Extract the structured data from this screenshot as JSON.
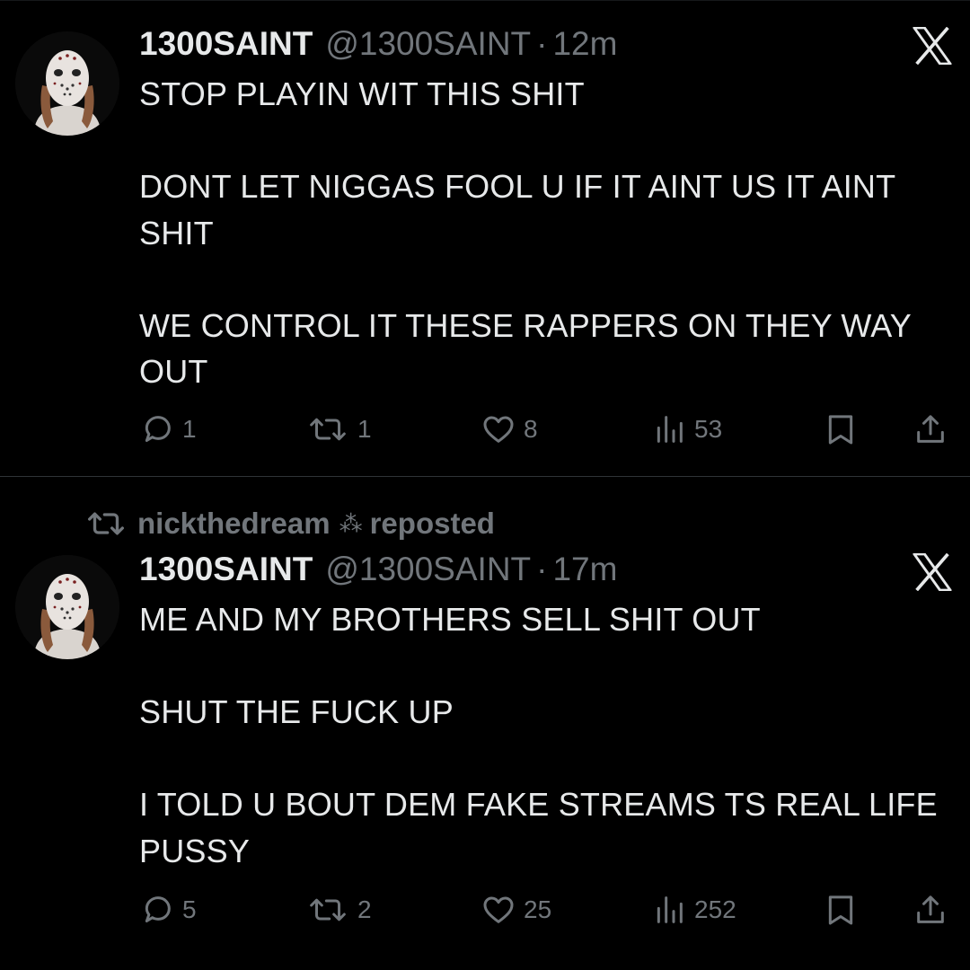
{
  "tweets": [
    {
      "author_name": "1300SAINT",
      "handle": "@1300SAINT",
      "separator": "·",
      "time": "12m",
      "text": "STOP PLAYIN WIT THIS SHIT\n\nDONT LET NIGGAS FOOL U IF IT AINT US IT AINT SHIT\n\nWE CONTROL IT THESE RAPPERS ON THEY WAY OUT",
      "replies": "1",
      "reposts": "1",
      "likes": "8",
      "views": "53"
    },
    {
      "repost_by": "nickthedream",
      "repost_sparkle": "⁂",
      "repost_label": "reposted",
      "author_name": "1300SAINT",
      "handle": "@1300SAINT",
      "separator": "·",
      "time": "17m",
      "text": "ME AND MY BROTHERS SELL SHIT OUT\n\nSHUT THE FUCK UP\n\nI TOLD U BOUT DEM FAKE STREAMS TS REAL LIFE PUSSY",
      "replies": "5",
      "reposts": "2",
      "likes": "25",
      "views": "252"
    }
  ],
  "icons": {
    "reply": "reply-icon",
    "repost": "repost-icon",
    "like": "heart-icon",
    "views": "views-icon",
    "bookmark": "bookmark-icon",
    "share": "share-icon",
    "x": "x-logo-icon"
  },
  "colors": {
    "background": "#000000",
    "text": "#e7e9ea",
    "muted": "#71767b",
    "divider": "#2f3336"
  }
}
